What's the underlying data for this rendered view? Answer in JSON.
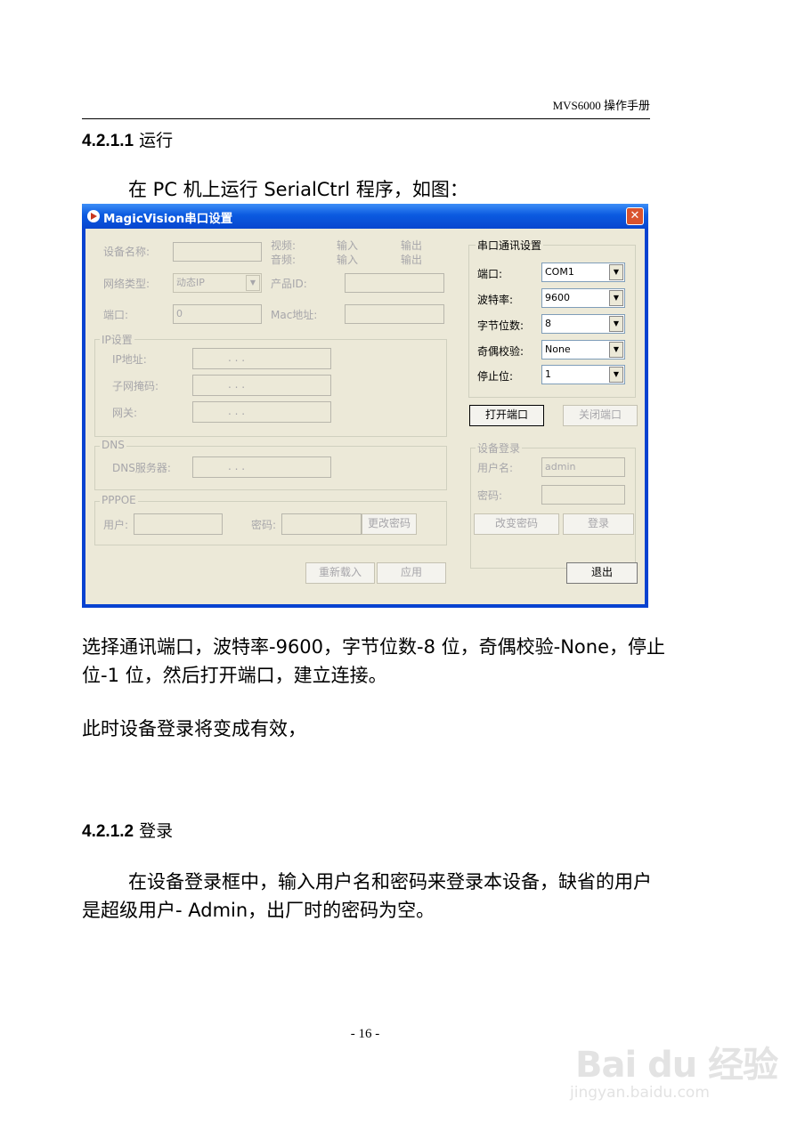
{
  "header": {
    "text": "MVS6000 操作手册"
  },
  "sections": [
    {
      "number": "4.2.1.1",
      "title": "运行"
    },
    {
      "number": "4.2.1.2",
      "title": "登录"
    }
  ],
  "paragraphs": {
    "intro": "在 PC 机上运行 SerialCtrl 程序，如图：",
    "select_line1": "选择通讯端口，波特率-9600，字节位数-8 位，奇偶校验-None，停止",
    "select_line2": "位-1 位，然后打开端口，建立连接。",
    "login_valid": "此时设备登录将变成有效，",
    "login_line1": "在设备登录框中，输入用户名和密码来登录本设备，缺省的用户",
    "login_line2": "是超级用户- Admin，出厂时的密码为空。"
  },
  "window": {
    "title": "MagicVision串口设置",
    "close_glyph": "✕",
    "device_name_label": "设备名称:",
    "video_label": "视频:",
    "audio_label": "音频:",
    "video_in": "输入",
    "video_out": "输出",
    "audio_in": "输入",
    "audio_out": "输出",
    "network_type_label": "网络类型:",
    "network_type_value": "动态IP",
    "product_id_label": "产品ID:",
    "port_label": "端口:",
    "port_value": "0",
    "mac_label": "Mac地址:",
    "ip_group": "IP设置",
    "ip_addr_label": "IP地址:",
    "subnet_label": "子网掩码:",
    "gateway_label": "网关:",
    "ip_dots": ".      .      .",
    "dns_group": "DNS",
    "dns_server_label": "DNS服务器:",
    "pppoe_group": "PPPOE",
    "user_label": "用户:",
    "password_label": "密码:",
    "change_pwd_button": "更改密码",
    "reload_button": "重新载入",
    "apply_button": "应用",
    "serial_group": "串口通讯设置",
    "com_port_label": "端口:",
    "com_port_value": "COM1",
    "baud_label": "波特率:",
    "baud_value": "9600",
    "databits_label": "字节位数:",
    "databits_value": "8",
    "parity_label": "奇偶校验:",
    "parity_value": "None",
    "stopbits_label": "停止位:",
    "stopbits_value": "1",
    "open_port_button": "打开端口",
    "close_port_button": "关闭端口",
    "login_group": "设备登录",
    "username_label": "用户名:",
    "username_value": "admin",
    "login_password_label": "密码:",
    "modify_pwd_button": "改变密码",
    "login_button": "登录",
    "exit_button": "退出",
    "combo_arrow": "▼"
  },
  "footer": {
    "page_number": "- 16 -"
  },
  "watermark": {
    "brand": "Bai du 经验",
    "url": "jingyan.baidu.com"
  }
}
